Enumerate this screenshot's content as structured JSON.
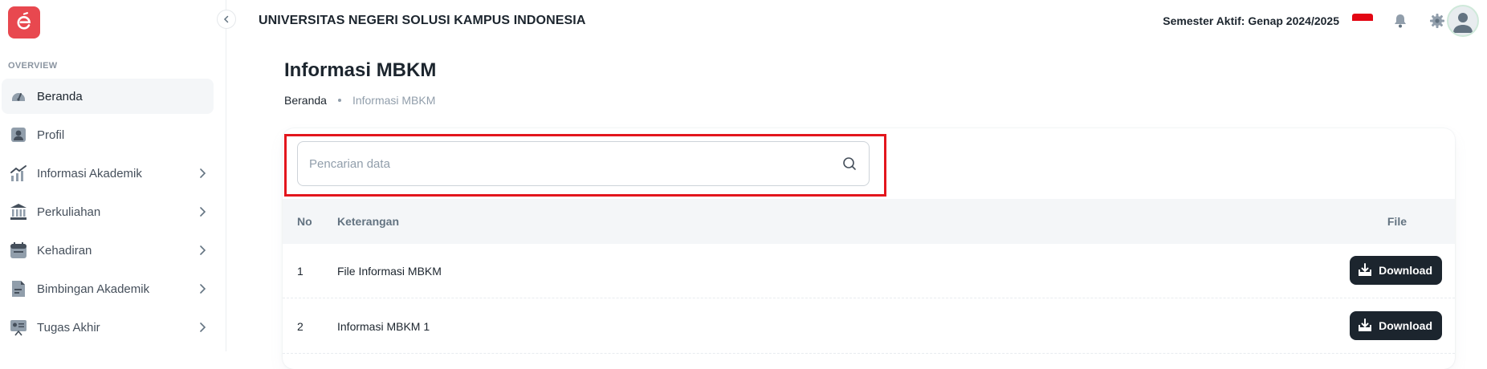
{
  "sidebar": {
    "logo_letter": "e",
    "section_label": "OVERVIEW",
    "items": [
      {
        "label": "Beranda",
        "icon": "dashboard-icon",
        "active": true,
        "has_submenu": false
      },
      {
        "label": "Profil",
        "icon": "user-icon",
        "active": false,
        "has_submenu": false
      },
      {
        "label": "Informasi Akademik",
        "icon": "analytics-icon",
        "active": false,
        "has_submenu": true
      },
      {
        "label": "Perkuliahan",
        "icon": "university-icon",
        "active": false,
        "has_submenu": true
      },
      {
        "label": "Kehadiran",
        "icon": "calendar-icon",
        "active": false,
        "has_submenu": true
      },
      {
        "label": "Bimbingan Akademik",
        "icon": "document-icon",
        "active": false,
        "has_submenu": true
      },
      {
        "label": "Tugas Akhir",
        "icon": "presentation-icon",
        "active": false,
        "has_submenu": true
      }
    ]
  },
  "header": {
    "university_name": "UNIVERSITAS NEGERI SOLUSI KAMPUS INDONESIA",
    "semester_label": "Semester Aktif: Genap 2024/2025",
    "flag": "indonesia-flag-icon",
    "notification_icon": "bell-icon",
    "settings_icon": "gear-icon",
    "avatar_icon": "avatar-icon"
  },
  "page": {
    "title": "Informasi MBKM",
    "breadcrumb": {
      "home": "Beranda",
      "current": "Informasi MBKM"
    }
  },
  "search": {
    "placeholder": "Pencarian data",
    "value": ""
  },
  "table": {
    "headers": {
      "no": "No",
      "keterangan": "Keterangan",
      "file": "File"
    },
    "rows": [
      {
        "no": "1",
        "keterangan": "File Informasi MBKM",
        "action": "Download"
      },
      {
        "no": "2",
        "keterangan": "Informasi MBKM 1",
        "action": "Download"
      }
    ]
  },
  "colors": {
    "brand": "#e8484f",
    "highlight": "#e3161d",
    "button": "#1c252e",
    "header_bg": "#f4f6f8"
  }
}
